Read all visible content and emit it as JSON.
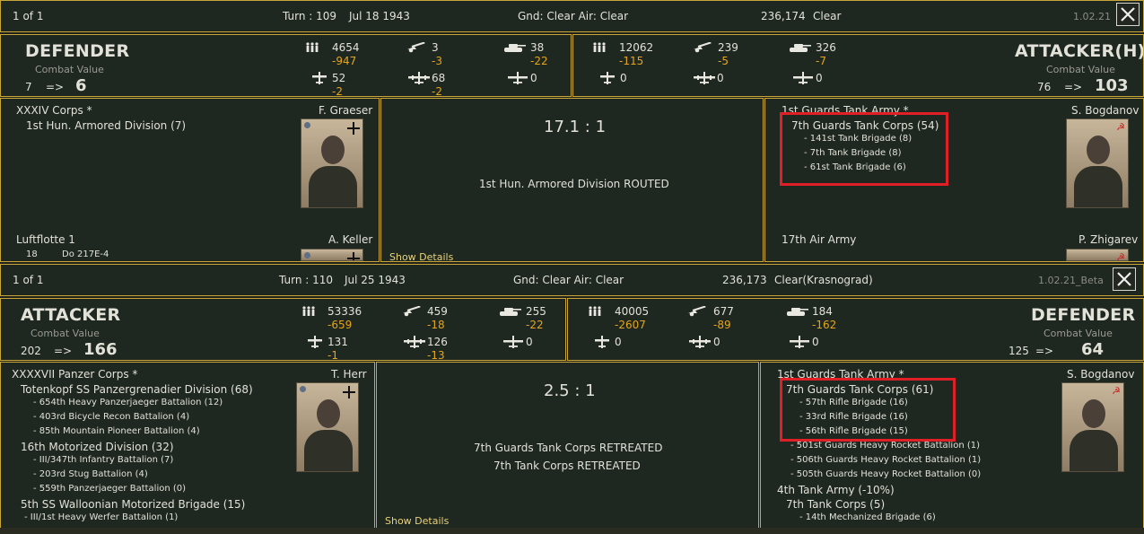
{
  "panel1": {
    "header": {
      "counter": "1 of 1",
      "turn": "Turn : 109",
      "date": "Jul 18 1943",
      "weather": "Gnd: Clear  Air: Clear",
      "hex": "236,174",
      "terrain": "Clear",
      "version": "1.02.21"
    },
    "left": {
      "role": "DEFENDER",
      "cv_label": "Combat Value",
      "cv_before": "7",
      "arrow": "=>",
      "cv_after": "6",
      "men": "4654",
      "men_loss": "-947",
      "guns": "3",
      "guns_loss": "-3",
      "afv": "38",
      "afv_loss": "-22",
      "air1": "52",
      "air1_loss": "-2",
      "air2": "68",
      "air2_loss": "-2",
      "air3": "0"
    },
    "right": {
      "role": "ATTACKER(H)",
      "cv_label": "Combat Value",
      "cv_before": "76",
      "arrow": "=>",
      "cv_after": "103",
      "men": "12062",
      "men_loss": "-115",
      "guns": "239",
      "guns_loss": "-5",
      "afv": "326",
      "afv_loss": "-7",
      "air1": "0",
      "air2": "0",
      "air3": "0"
    },
    "left_units": {
      "hq": "XXXIV Corps *",
      "leader": "F. Graeser",
      "units": [
        "1st Hun. Armored Division (7)"
      ],
      "air_hq": "Luftflotte 1",
      "air_leader": "A. Keller",
      "air_count": "18",
      "air_type": "Do 217E-4"
    },
    "center": {
      "odds": "17.1 : 1",
      "results": [
        "1st Hun. Armored Division ROUTED"
      ],
      "show_details": "Show Details"
    },
    "right_units": {
      "hq": "1st Guards Tank Army *",
      "leader": "S. Bogdanov",
      "corps": "7th Guards Tank Corps (54)",
      "subunits": [
        "- 141st Tank Brigade (8)",
        "- 7th Tank Brigade (8)",
        "- 61st Tank Brigade (6)"
      ],
      "air_hq": "17th Air Army",
      "air_leader": "P. Zhigarev"
    }
  },
  "panel2": {
    "header": {
      "counter": "1 of 1",
      "turn": "Turn : 110",
      "date": "Jul 25 1943",
      "weather": "Gnd: Clear  Air: Clear",
      "hex": "236,173",
      "terrain": "Clear(Krasnograd)",
      "version": "1.02.21_Beta"
    },
    "left": {
      "role": "ATTACKER",
      "cv_label": "Combat Value",
      "cv_before": "202",
      "arrow": "=>",
      "cv_after": "166",
      "men": "53336",
      "men_loss": "-659",
      "guns": "459",
      "guns_loss": "-18",
      "afv": "255",
      "afv_loss": "-22",
      "air1": "131",
      "air1_loss": "-1",
      "air2": "126",
      "air2_loss": "-13",
      "air3": "0"
    },
    "right": {
      "role": "DEFENDER",
      "cv_label": "Combat Value",
      "cv_before": "125",
      "arrow": "=>",
      "cv_after": "64",
      "men": "40005",
      "men_loss": "-2607",
      "guns": "677",
      "guns_loss": "-89",
      "afv": "184",
      "afv_loss": "-162",
      "air1": "0",
      "air2": "0",
      "air3": "0"
    },
    "left_units": {
      "hq": "XXXXVII Panzer Corps *",
      "leader": "T. Herr",
      "div1": "Totenkopf SS Panzergrenadier Division (68)",
      "div1_sub": [
        "- 654th Heavy Panzerjaeger Battalion (12)",
        "- 403rd Bicycle Recon Battalion (4)",
        "- 85th Mountain Pioneer Battalion (4)"
      ],
      "div2": "16th Motorized Division (32)",
      "div2_sub": [
        "- III/347th Infantry Battalion (7)",
        "- 203rd Stug Battalion (4)",
        "- 559th Panzerjaeger Battalion (0)"
      ],
      "div3": "5th SS Walloonian Motorized Brigade (15)",
      "div3_sub": [
        "- III/1st Heavy Werfer Battalion (1)"
      ]
    },
    "center": {
      "odds": "2.5 : 1",
      "results": [
        "7th Guards Tank Corps RETREATED",
        "7th Tank Corps RETREATED"
      ],
      "show_details": "Show Details"
    },
    "right_units": {
      "hq": "1st Guards Tank Army *",
      "leader": "S. Bogdanov",
      "corps": "7th Guards Tank Corps (61)",
      "corps_sub": [
        "- 57th Rifle Brigade (16)",
        "- 33rd Rifle Brigade (16)",
        "- 56th Rifle Brigade (15)"
      ],
      "extra_sub": [
        "- 501st Guards Heavy Rocket Battalion (1)",
        "- 506th Guards Heavy Rocket Battalion (1)",
        "- 505th Guards Heavy Rocket Battalion (0)"
      ],
      "army2": "4th Tank Army (-10%)",
      "corps2": "7th Tank Corps (5)",
      "corps2_sub": [
        "- 14th Mechanized Brigade (6)"
      ]
    }
  },
  "icons": {
    "men": "infantry-icon",
    "guns": "artillery-icon",
    "afv": "tank-icon",
    "air1": "fighter-icon",
    "air2": "bomber-icon",
    "air3": "transport-plane-icon",
    "close": "close-icon"
  },
  "colors": {
    "accent_border": "#c9a63a",
    "loss": "#e6a51a",
    "highlight": "#e01f26"
  }
}
